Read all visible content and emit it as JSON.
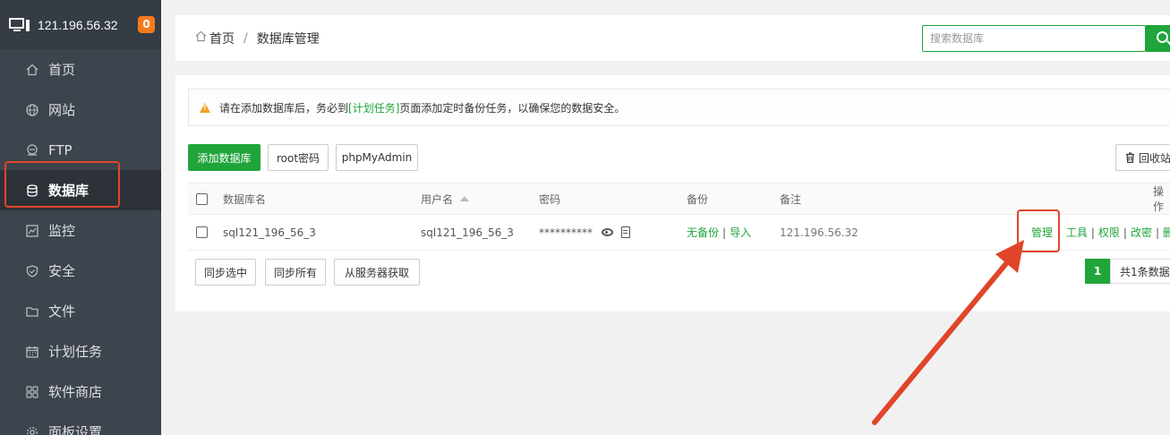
{
  "server": {
    "ip": "121.196.56.32",
    "notification_count": "0"
  },
  "sidebar": {
    "items": [
      {
        "label": "首页",
        "icon": "home-icon"
      },
      {
        "label": "网站",
        "icon": "globe-icon"
      },
      {
        "label": "FTP",
        "icon": "ftp-icon"
      },
      {
        "label": "数据库",
        "icon": "database-icon",
        "active": true
      },
      {
        "label": "监控",
        "icon": "monitor-chart-icon"
      },
      {
        "label": "安全",
        "icon": "shield-icon"
      },
      {
        "label": "文件",
        "icon": "folder-icon"
      },
      {
        "label": "计划任务",
        "icon": "calendar-icon"
      },
      {
        "label": "软件商店",
        "icon": "apps-grid-icon"
      },
      {
        "label": "面板设置",
        "icon": "gear-icon"
      }
    ]
  },
  "breadcrumb": {
    "home": "首页",
    "separator": "/",
    "current": "数据库管理"
  },
  "search": {
    "placeholder": "搜索数据库"
  },
  "alert": {
    "text_before": "请在添加数据库后，务必到",
    "link": "[计划任务]",
    "text_after": "页面添加定时备份任务，以确保您的数据安全。"
  },
  "toolbar": {
    "add_db": "添加数据库",
    "root_pwd": "root密码",
    "phpmyadmin": "phpMyAdmin",
    "recycle_bin": "回收站"
  },
  "table": {
    "headers": {
      "name": "数据库名",
      "user": "用户名",
      "password": "密码",
      "backup": "备份",
      "note": "备注",
      "actions": "操作"
    },
    "rows": [
      {
        "name": "sql121_196_56_3",
        "user": "sql121_196_56_3",
        "password": "**********",
        "backup_none": "无备份",
        "import": "导入",
        "note": "121.196.56.32",
        "act_manage": "管理",
        "act_tools": "工具",
        "act_perm": "权限",
        "act_pwd": "改密",
        "act_delete": "删除"
      }
    ]
  },
  "footer": {
    "sync_selected": "同步选中",
    "sync_all": "同步所有",
    "fetch_server": "从服务器获取",
    "page": "1",
    "total": "共1条数据"
  },
  "colors": {
    "accent": "#20a53a",
    "sidebar": "#3c444d",
    "highlight": "#e0452a",
    "badge": "#f37b1d"
  }
}
